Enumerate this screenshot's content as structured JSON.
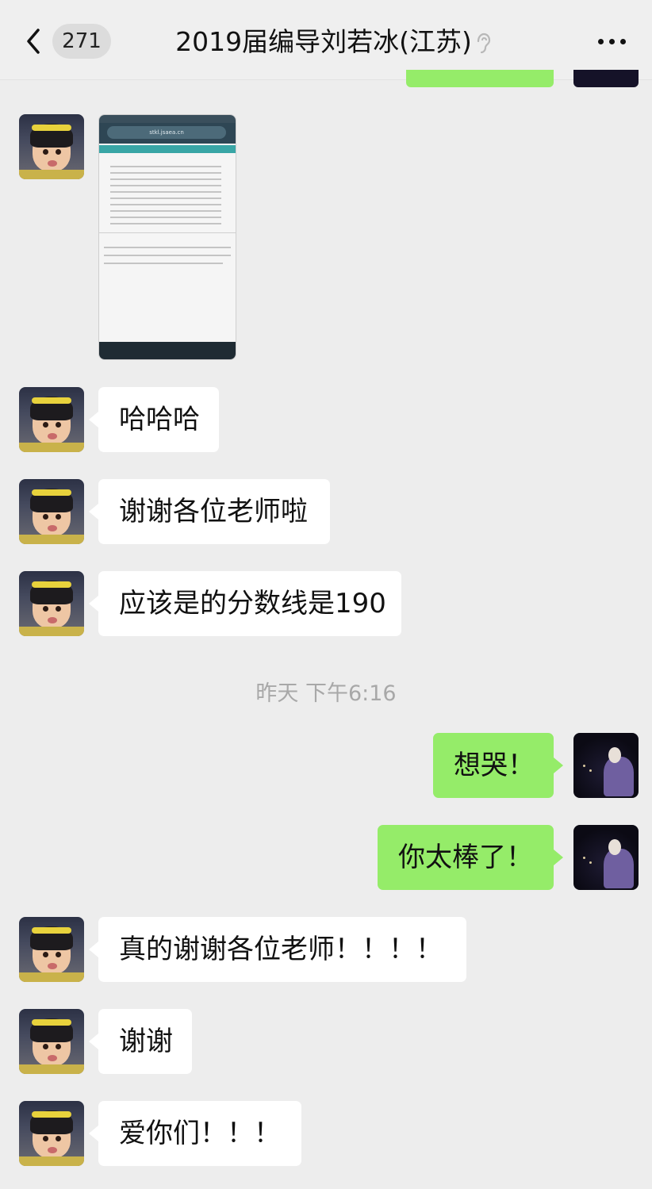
{
  "header": {
    "unread_count": "271",
    "title": "2019届编导刘若冰(江苏)",
    "back_icon": "chevron-left-icon",
    "more_icon": "more-dots-icon",
    "mute_icon": "ear-icon"
  },
  "messages": [
    {
      "side": "left",
      "type": "image",
      "url_text": "stkl.jsaea.cn"
    },
    {
      "side": "left",
      "text": "哈哈哈"
    },
    {
      "side": "left",
      "text": "谢谢各位老师啦"
    },
    {
      "side": "left",
      "text": "应该是的分数线是190"
    },
    {
      "side": "right",
      "text": "想哭！"
    },
    {
      "side": "right",
      "text": "你太棒了！"
    },
    {
      "side": "left",
      "text": "真的谢谢各位老师！！！！"
    },
    {
      "side": "left",
      "text": "谢谢"
    },
    {
      "side": "left",
      "text": "爱你们！！！"
    }
  ],
  "timestamp": "昨天 下午6:16",
  "colors": {
    "background": "#ededed",
    "bubble_self": "#95ec69",
    "bubble_other": "#ffffff",
    "timestamp": "#a8a8a8"
  }
}
